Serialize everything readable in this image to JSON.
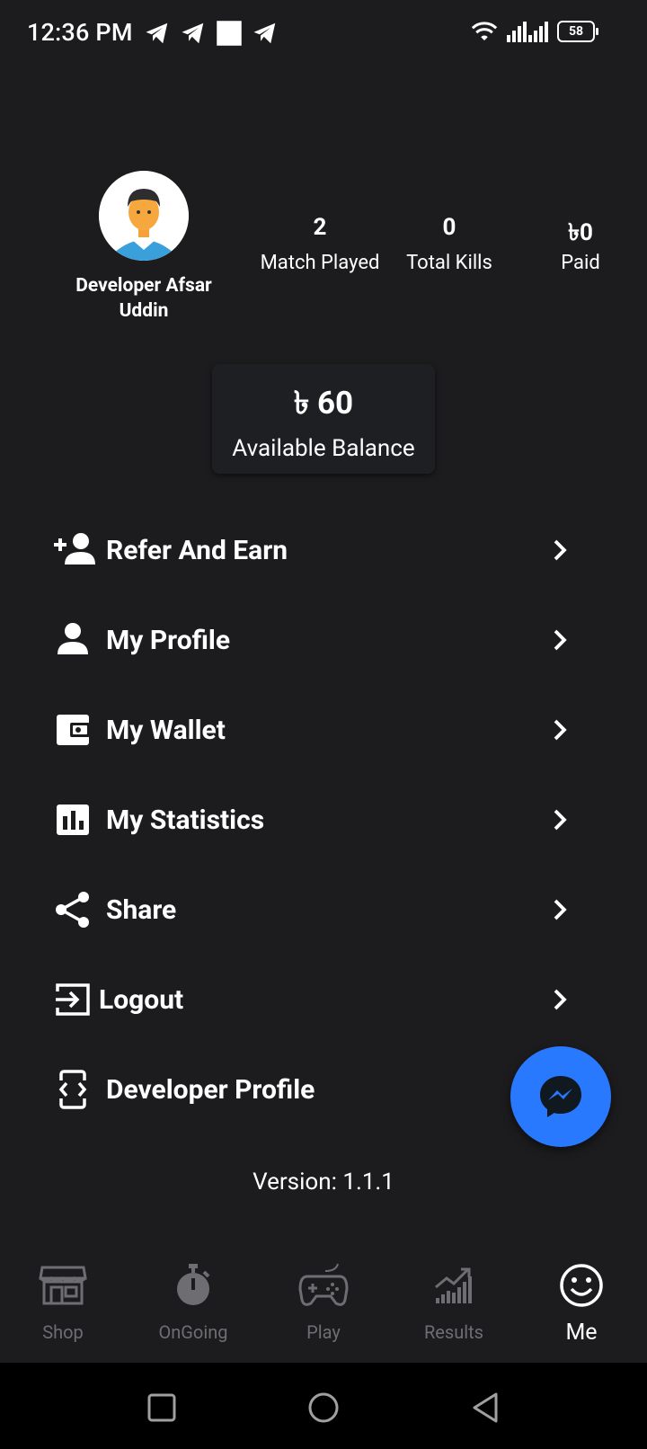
{
  "status_bar": {
    "time": "12:36 PM",
    "battery": "58"
  },
  "profile": {
    "name": "Developer Afsar Uddin",
    "stats": [
      {
        "value": "2",
        "label": "Match Played"
      },
      {
        "value": "0",
        "label": "Total Kills"
      },
      {
        "value": "৳0",
        "label": "Paid"
      }
    ]
  },
  "balance": {
    "amount": "৳ 60",
    "label": "Available Balance"
  },
  "menu": [
    {
      "label": "Refer And Earn",
      "icon": "person-add-icon"
    },
    {
      "label": "My Profile",
      "icon": "person-icon"
    },
    {
      "label": "My Wallet",
      "icon": "wallet-icon"
    },
    {
      "label": "My Statistics",
      "icon": "statistics-icon"
    },
    {
      "label": "Share",
      "icon": "share-icon"
    },
    {
      "label": "Logout",
      "icon": "logout-icon"
    },
    {
      "label": "Developer Profile",
      "icon": "developer-icon"
    }
  ],
  "version": "Version: 1.1.1",
  "bottom_nav": [
    {
      "label": "Shop",
      "icon": "shop-icon"
    },
    {
      "label": "OnGoing",
      "icon": "stopwatch-icon"
    },
    {
      "label": "Play",
      "icon": "gamepad-icon"
    },
    {
      "label": "Results",
      "icon": "results-icon"
    },
    {
      "label": "Me",
      "icon": "smiley-icon",
      "active": true
    }
  ],
  "colors": {
    "background": "#1c1c1e",
    "fab": "#2979ff",
    "inactive_nav": "#6e6e72"
  }
}
